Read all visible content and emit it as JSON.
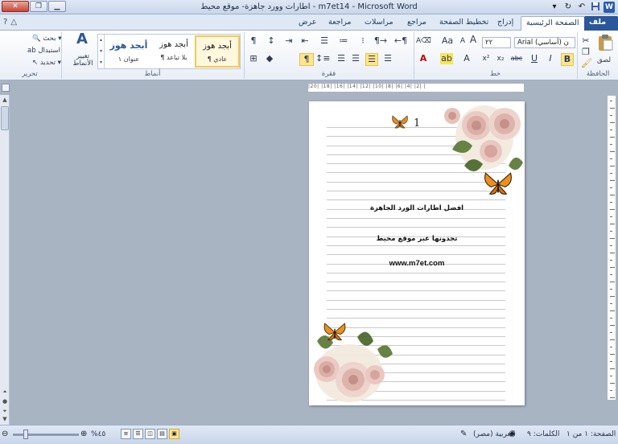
{
  "window": {
    "title": "اطارات وورد جاهزة- موقع محيط - m7et14 - Microsoft Word",
    "minimize": "▁",
    "restore": "❐",
    "close": "✕"
  },
  "tabs": {
    "file": "ملف",
    "home": "الصفحة الرئيسية",
    "insert": "إدراج",
    "page_layout": "تخطيط الصفحة",
    "references": "مراجع",
    "mailings": "مراسلات",
    "review": "مراجعة",
    "view": "عرض"
  },
  "ribbon": {
    "clipboard": {
      "label": "الحافظة",
      "paste": "لصق"
    },
    "font": {
      "label": "خط",
      "font_name": "Arial (أساسي) ن",
      "font_size": "٢٢",
      "bold": "B",
      "italic": "I",
      "underline": "U",
      "strike": "abc",
      "subscript": "x₂",
      "superscript": "x²",
      "grow": "A",
      "shrink": "A",
      "change_case": "Aa",
      "font_color": "A",
      "highlight": "ab"
    },
    "paragraph": {
      "label": "فقرة",
      "show_marks": "¶"
    },
    "styles": {
      "label": "أنماط",
      "normal_preview": "أبجد هوز",
      "normal_name": "¶ عادي",
      "nospacing_preview": "أبجد هوز",
      "nospacing_name": "¶ بلا تباعد",
      "heading1_preview": "أبجد هوز",
      "heading1_name": "عنوان ١",
      "change_styles": "تغيير الأنماط"
    },
    "editing": {
      "label": "تحرير",
      "find": "بحث",
      "replace": "استبدال",
      "select": "تحديد"
    }
  },
  "ruler": {
    "text": "|20|  |18|  |16|  |14|  |12|  |10|  |8|  |6|  |4|  |2|  |"
  },
  "document": {
    "page_number": "1",
    "line1": "افضل اطارات الورد الجاهزة",
    "line2": "تجدونها عبر موقع محيط",
    "line3": "www.m7et.com"
  },
  "status": {
    "page": "الصفحة: ١ من ١",
    "words": "الكلمات: ٩",
    "language": "العربية (مصر)",
    "zoom": "%٤٥",
    "zoom_level": 45
  },
  "colors": {
    "file_tab": "#2b579a",
    "ribbon_bg": "#e9eef6",
    "workspace": "#a9b4c3",
    "selected_style": "#f3c85a"
  },
  "icons": {
    "rose": "rose-flower-icon",
    "butterfly": "butterfly-icon"
  }
}
